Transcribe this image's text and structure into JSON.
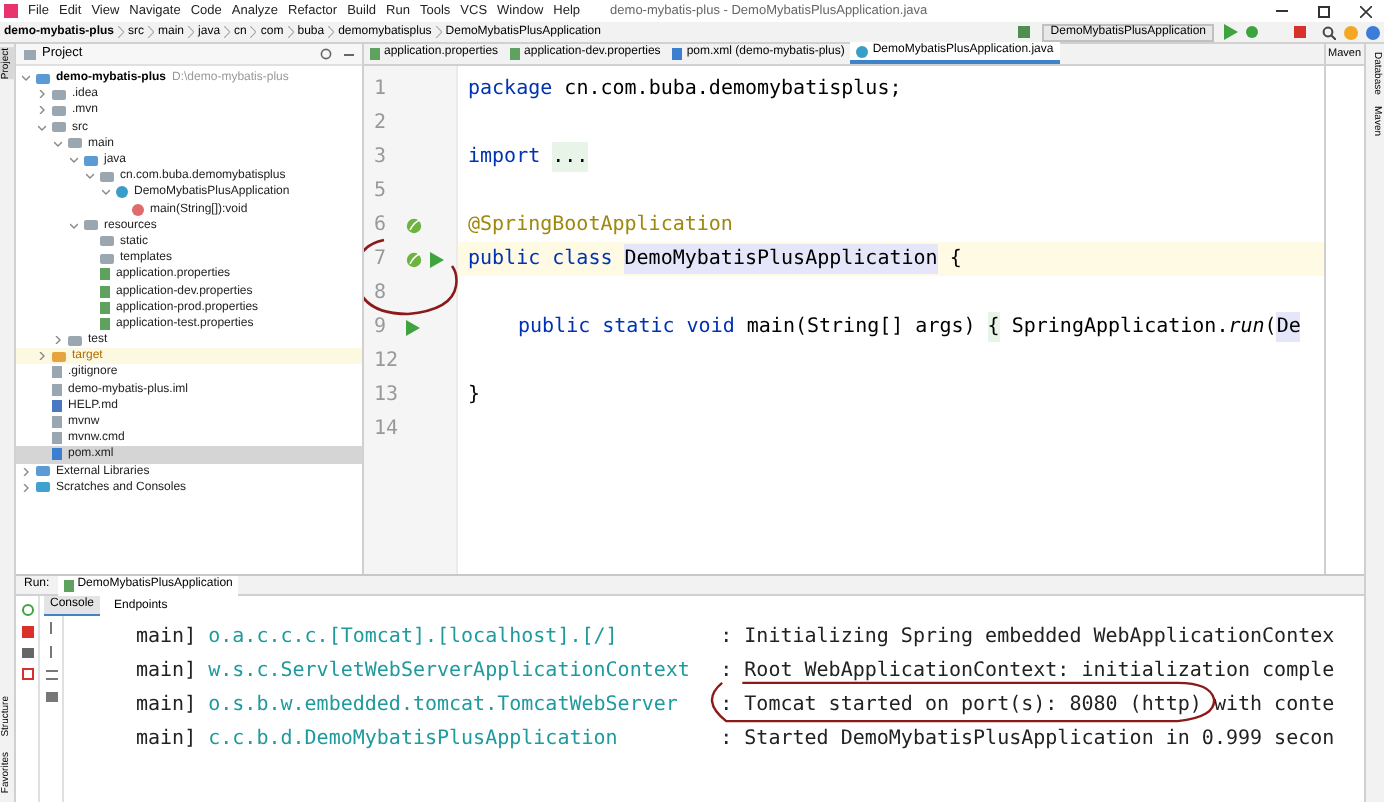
{
  "window": {
    "title": "demo-mybatis-plus - DemoMybatisPlusApplication.java"
  },
  "menu": [
    "File",
    "Edit",
    "View",
    "Navigate",
    "Code",
    "Analyze",
    "Refactor",
    "Build",
    "Run",
    "Tools",
    "VCS",
    "Window",
    "Help"
  ],
  "breadcrumbs": [
    "demo-mybatis-plus",
    "src",
    "main",
    "java",
    "cn",
    "com",
    "buba",
    "demomybatisplus",
    "DemoMybatisPlusApplication"
  ],
  "run_configuration": "DemoMybatisPlusApplication",
  "left_tool_tabs": [
    {
      "label": "Project",
      "selected": true
    },
    {
      "label": "Structure",
      "selected": false
    },
    {
      "label": "Favorites",
      "selected": false
    }
  ],
  "project_panel": {
    "title": "Project",
    "tree": [
      {
        "label": "demo-mybatis-plus",
        "path": "D:\\demo-mybatis-plus",
        "kind": "module",
        "expanded": true,
        "selected": false,
        "children": [
          {
            "label": ".idea",
            "kind": "folder",
            "expanded": false,
            "selected": false
          },
          {
            "label": ".mvn",
            "kind": "folder",
            "expanded": false,
            "selected": false
          },
          {
            "label": "src",
            "kind": "folder",
            "expanded": true,
            "selected": false,
            "children": [
              {
                "label": "main",
                "kind": "folder",
                "expanded": true,
                "selected": false,
                "children": [
                  {
                    "label": "java",
                    "kind": "source",
                    "expanded": true,
                    "selected": false,
                    "children": [
                      {
                        "label": "cn.com.buba.demomybatisplus",
                        "kind": "package",
                        "expanded": true,
                        "selected": false,
                        "children": [
                          {
                            "label": "DemoMybatisPlusApplication",
                            "kind": "class",
                            "expanded": true,
                            "selected": false,
                            "children": [
                              {
                                "label": "main(String[]):void",
                                "kind": "method",
                                "selected": false
                              }
                            ]
                          }
                        ]
                      }
                    ]
                  },
                  {
                    "label": "resources",
                    "kind": "resources",
                    "expanded": true,
                    "selected": false,
                    "children": [
                      {
                        "label": "static",
                        "kind": "folder",
                        "selected": false
                      },
                      {
                        "label": "templates",
                        "kind": "folder",
                        "selected": false
                      },
                      {
                        "label": "application.properties",
                        "kind": "properties",
                        "selected": false
                      },
                      {
                        "label": "application-dev.properties",
                        "kind": "properties",
                        "selected": false
                      },
                      {
                        "label": "application-prod.properties",
                        "kind": "properties",
                        "selected": false
                      },
                      {
                        "label": "application-test.properties",
                        "kind": "properties",
                        "selected": false
                      }
                    ]
                  }
                ]
              },
              {
                "label": "test",
                "kind": "folder",
                "expanded": false,
                "selected": false
              }
            ]
          },
          {
            "label": "target",
            "kind": "excluded",
            "expanded": false,
            "selected": false
          },
          {
            "label": ".gitignore",
            "kind": "file",
            "selected": false
          },
          {
            "label": "demo-mybatis-plus.iml",
            "kind": "file",
            "selected": false
          },
          {
            "label": "HELP.md",
            "kind": "markdown",
            "selected": false
          },
          {
            "label": "mvnw",
            "kind": "file",
            "selected": false
          },
          {
            "label": "mvnw.cmd",
            "kind": "file",
            "selected": false
          },
          {
            "label": "pom.xml",
            "kind": "xml",
            "selected": true
          }
        ]
      },
      {
        "label": "External Libraries",
        "kind": "library",
        "expanded": false,
        "selected": false
      },
      {
        "label": "Scratches and Consoles",
        "kind": "scratches",
        "expanded": false,
        "selected": false
      }
    ]
  },
  "editor_tabs": [
    {
      "label": "application.properties",
      "kind": "properties",
      "selected": false
    },
    {
      "label": "application-dev.properties",
      "kind": "properties",
      "selected": false
    },
    {
      "label": "pom.xml (demo-mybatis-plus)",
      "kind": "xml",
      "selected": false
    },
    {
      "label": "DemoMybatisPlusApplication.java",
      "kind": "class",
      "selected": true
    }
  ],
  "maven_panel": {
    "title": "Maven"
  },
  "right_tool_tabs": [
    "Database",
    "Maven"
  ],
  "editor": {
    "lines": [
      {
        "number": "1",
        "current": false,
        "spring": false,
        "runnable": false,
        "circled": false,
        "code": [
          {
            "kind": "keyword",
            "text": "package"
          },
          {
            "kind": "plain",
            "text": "cn.com.buba.demomybatisplus;",
            "spaced": true
          }
        ]
      },
      {
        "number": "2",
        "current": false,
        "spring": false,
        "runnable": false,
        "circled": false
      },
      {
        "number": "3",
        "current": false,
        "spring": false,
        "runnable": false,
        "circled": false,
        "code": [
          {
            "kind": "keyword",
            "text": "import"
          },
          {
            "kind": "folded",
            "text": "...",
            "spaced": true
          }
        ]
      },
      {
        "number": "5",
        "current": false,
        "spring": false,
        "runnable": false,
        "circled": false
      },
      {
        "number": "6",
        "current": false,
        "spring": true,
        "runnable": false,
        "circled": false,
        "code": [
          {
            "kind": "annotation",
            "text": "@SpringBootApplication"
          }
        ]
      },
      {
        "number": "7",
        "current": true,
        "spring": true,
        "runnable": true,
        "circled": true,
        "code": [
          {
            "kind": "keyword",
            "text": "public class"
          },
          {
            "kind": "highlight",
            "text": "DemoMybatisPlusApplication",
            "spaced": true
          },
          {
            "kind": "plain",
            "text": "{",
            "spaced": true
          }
        ]
      },
      {
        "number": "8",
        "current": false,
        "spring": false,
        "runnable": false,
        "circled": false
      },
      {
        "number": "9",
        "current": false,
        "spring": false,
        "runnable": true,
        "circled": false,
        "indented": true,
        "code": [
          {
            "kind": "keyword",
            "text": "public static void"
          },
          {
            "kind": "plain",
            "text": "main(String[] args)",
            "spaced": true
          },
          {
            "kind": "folded",
            "text": "{",
            "spaced": true
          },
          {
            "kind": "plain",
            "text": "SpringApplication.",
            "spaced": true
          },
          {
            "kind": "italic",
            "text": "run"
          },
          {
            "kind": "plain",
            "text": "("
          },
          {
            "kind": "highlight",
            "text": "De"
          }
        ]
      },
      {
        "number": "12",
        "current": false,
        "spring": false,
        "runnable": false,
        "circled": false
      },
      {
        "number": "13",
        "current": false,
        "spring": false,
        "runnable": false,
        "circled": false,
        "code": [
          {
            "kind": "plain",
            "text": "}"
          }
        ]
      },
      {
        "number": "14",
        "current": false,
        "spring": false,
        "runnable": false,
        "circled": false
      }
    ]
  },
  "run_panel": {
    "label": "Run:",
    "tab": "DemoMybatisPlusApplication",
    "subtabs": [
      {
        "label": "Console",
        "selected": true
      },
      {
        "label": "Endpoints",
        "selected": false
      }
    ],
    "lines": [
      {
        "thread": "main]",
        "logger": "o.a.c.c.c.[Tomcat].[localhost].[/]",
        "message": ": Initializing Spring embedded WebApplicationContex",
        "circled": false
      },
      {
        "thread": "main]",
        "logger": "w.s.c.ServletWebServerApplicationContext",
        "message": ": Root WebApplicationContext: initialization comple",
        "circled": false
      },
      {
        "thread": "main]",
        "logger": "o.s.b.w.embedded.tomcat.TomcatWebServer",
        "message": ": Tomcat started on port(s): 8080 (http) with conte",
        "circled": true
      },
      {
        "thread": "main]",
        "logger": "c.c.b.d.DemoMybatisPlusApplication",
        "message": ": Started DemoMybatisPlusApplication in 0.999 secon",
        "circled": false
      }
    ]
  }
}
